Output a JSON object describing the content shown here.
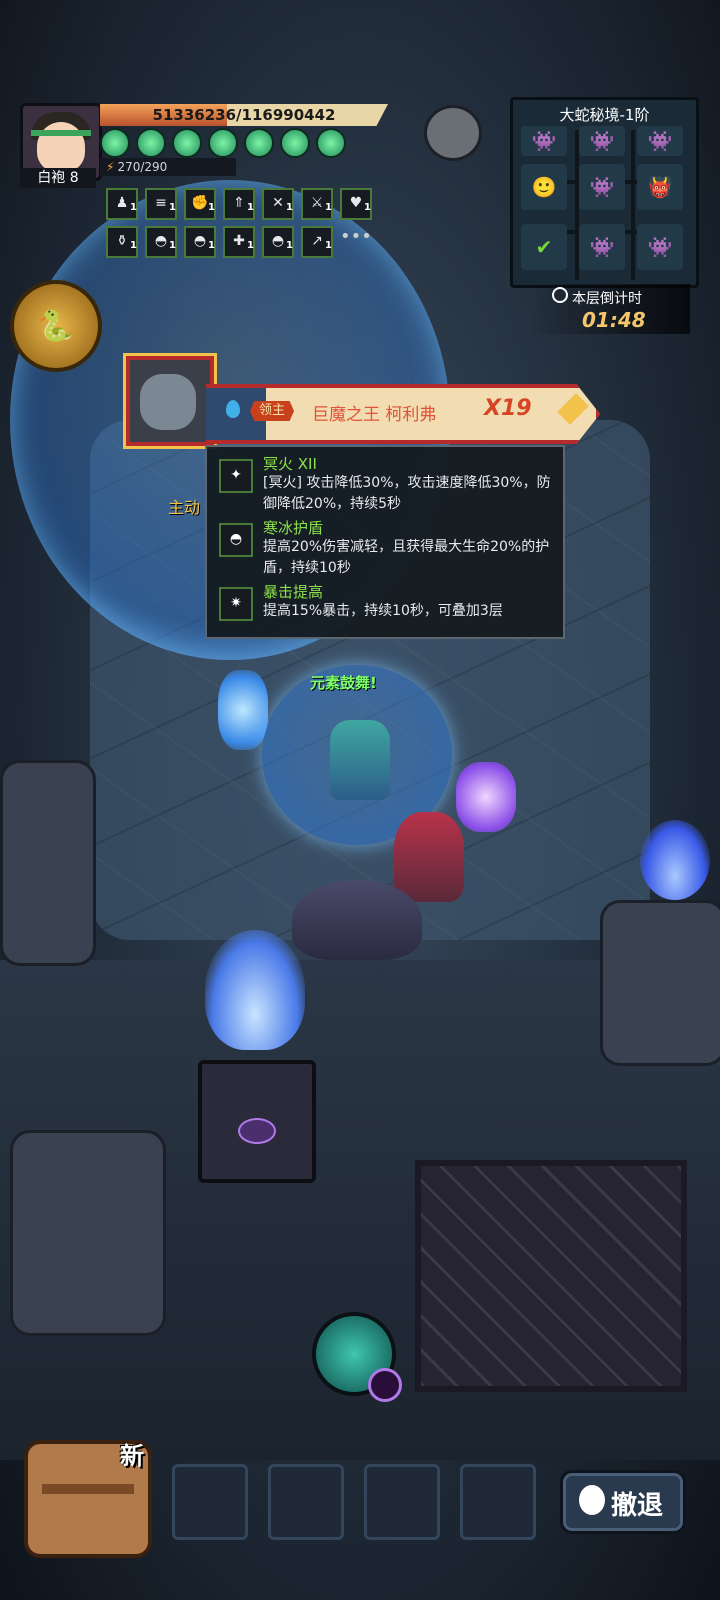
{
  "player": {
    "name": "白袍 8",
    "hp_text": "51336236/116990442",
    "hp_fraction": 0.44,
    "energy_text": "270/290",
    "gem_count": 7
  },
  "skills_row1": [
    {
      "icon": "idol-icon",
      "level": "1"
    },
    {
      "icon": "scroll-icon",
      "level": "1"
    },
    {
      "icon": "muscle-icon",
      "level": "1"
    },
    {
      "icon": "rank-up-icon",
      "level": "1"
    },
    {
      "icon": "cross-swords-icon",
      "level": "1"
    },
    {
      "icon": "sword-icon",
      "level": "1"
    },
    {
      "icon": "heart-shield-icon",
      "level": "1"
    }
  ],
  "skills_row2": [
    {
      "icon": "potion-icon",
      "level": "1"
    },
    {
      "icon": "ice-shield-icon",
      "level": "1"
    },
    {
      "icon": "ice-shield-icon",
      "level": "1"
    },
    {
      "icon": "heal-plus-icon",
      "level": "1"
    },
    {
      "icon": "ice-shield-icon",
      "level": "1"
    },
    {
      "icon": "spear-icon",
      "level": "1"
    }
  ],
  "more_label": "•••",
  "minimap": {
    "title": "大蛇秘境-1阶",
    "timer_label": "本层倒计时",
    "timer_value": "01:48"
  },
  "boss": {
    "tag": "领主",
    "name": "巨魔之王 柯利弗",
    "multiplier": "X19"
  },
  "active_label": "主动",
  "tooltip": [
    {
      "title": "冥火 XII",
      "desc": "[冥火] 攻击降低30%，攻击速度降低30%，防御降低20%，持续5秒",
      "icon": "dark-fire-icon"
    },
    {
      "title": "寒冰护盾",
      "desc": "提高20%伤害减轻，且获得最大生命20%的护盾，持续10秒",
      "icon": "ice-shield-icon"
    },
    {
      "title": "暴击提高",
      "desc": "提高15%暴击，持续10秒，可叠加3层",
      "icon": "crit-burst-icon"
    }
  ],
  "hero_effect": "元素鼓舞!",
  "bottom": {
    "new_badge": "新",
    "retreat_label": "撤退"
  },
  "colors": {
    "accent_gold": "#f3c24a",
    "boss_red": "#b52a2a",
    "skill_green": "#8ce04a"
  }
}
